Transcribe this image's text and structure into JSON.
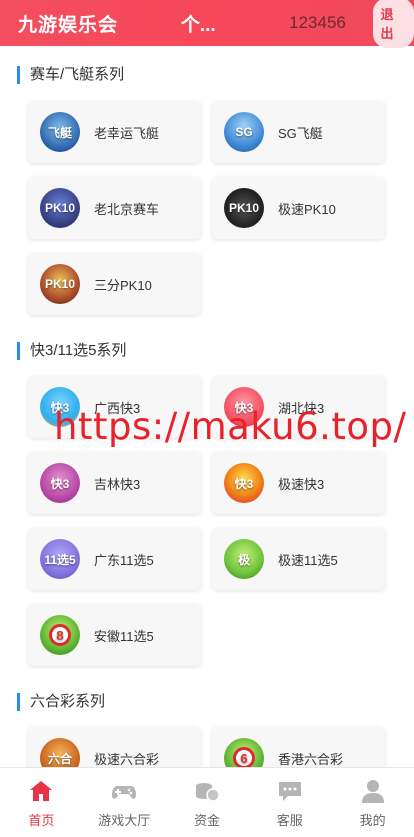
{
  "header": {
    "brand": "九游娱乐会",
    "center": "个...",
    "user_id": "123456",
    "logout": "退出"
  },
  "sections": [
    {
      "title": "赛车/飞艇系列",
      "games": [
        {
          "label": "老幸运飞艇",
          "icon": "lucky-boat-icon",
          "glyph": "飞艇"
        },
        {
          "label": "SG飞艇",
          "icon": "sg-boat-icon",
          "glyph": "SG"
        },
        {
          "label": "老北京赛车",
          "icon": "beijing-racing-icon",
          "glyph": "PK10"
        },
        {
          "label": "极速PK10",
          "icon": "speed-pk10-icon",
          "glyph": "PK10"
        },
        {
          "label": "三分PK10",
          "icon": "three-min-pk10-icon",
          "glyph": "PK10"
        }
      ]
    },
    {
      "title": "快3/11选5系列",
      "games": [
        {
          "label": "广西快3",
          "icon": "guangxi-k3-icon",
          "glyph": "快3"
        },
        {
          "label": "湖北快3",
          "icon": "hubei-k3-icon",
          "glyph": "快3"
        },
        {
          "label": "吉林快3",
          "icon": "jilin-k3-icon",
          "glyph": "快3"
        },
        {
          "label": "极速快3",
          "icon": "speed-k3-icon",
          "glyph": "快3"
        },
        {
          "label": "广东11选5",
          "icon": "guangdong-11x5-icon",
          "glyph": "11选5"
        },
        {
          "label": "极速11选5",
          "icon": "speed-11x5-icon",
          "glyph": "极"
        },
        {
          "label": "安徽11选5",
          "icon": "anhui-11x5-icon",
          "glyph": "8"
        }
      ]
    },
    {
      "title": "六合彩系列",
      "games": [
        {
          "label": "极速六合彩",
          "icon": "speed-lhc-icon",
          "glyph": "六合"
        },
        {
          "label": "香港六合彩",
          "icon": "hongkong-lhc-icon",
          "glyph": "6"
        }
      ]
    }
  ],
  "watermark": "https://maku6.top/",
  "nav": [
    {
      "label": "首页",
      "icon": "home-icon",
      "active": true
    },
    {
      "label": "游戏大厅",
      "icon": "gamepad-icon",
      "active": false
    },
    {
      "label": "资金",
      "icon": "coins-icon",
      "active": false
    },
    {
      "label": "客服",
      "icon": "chat-icon",
      "active": false
    },
    {
      "label": "我的",
      "icon": "user-icon",
      "active": false
    }
  ],
  "colors": {
    "header": "#f34e5f",
    "accent": "#2a8cf0",
    "active": "#e83347"
  }
}
